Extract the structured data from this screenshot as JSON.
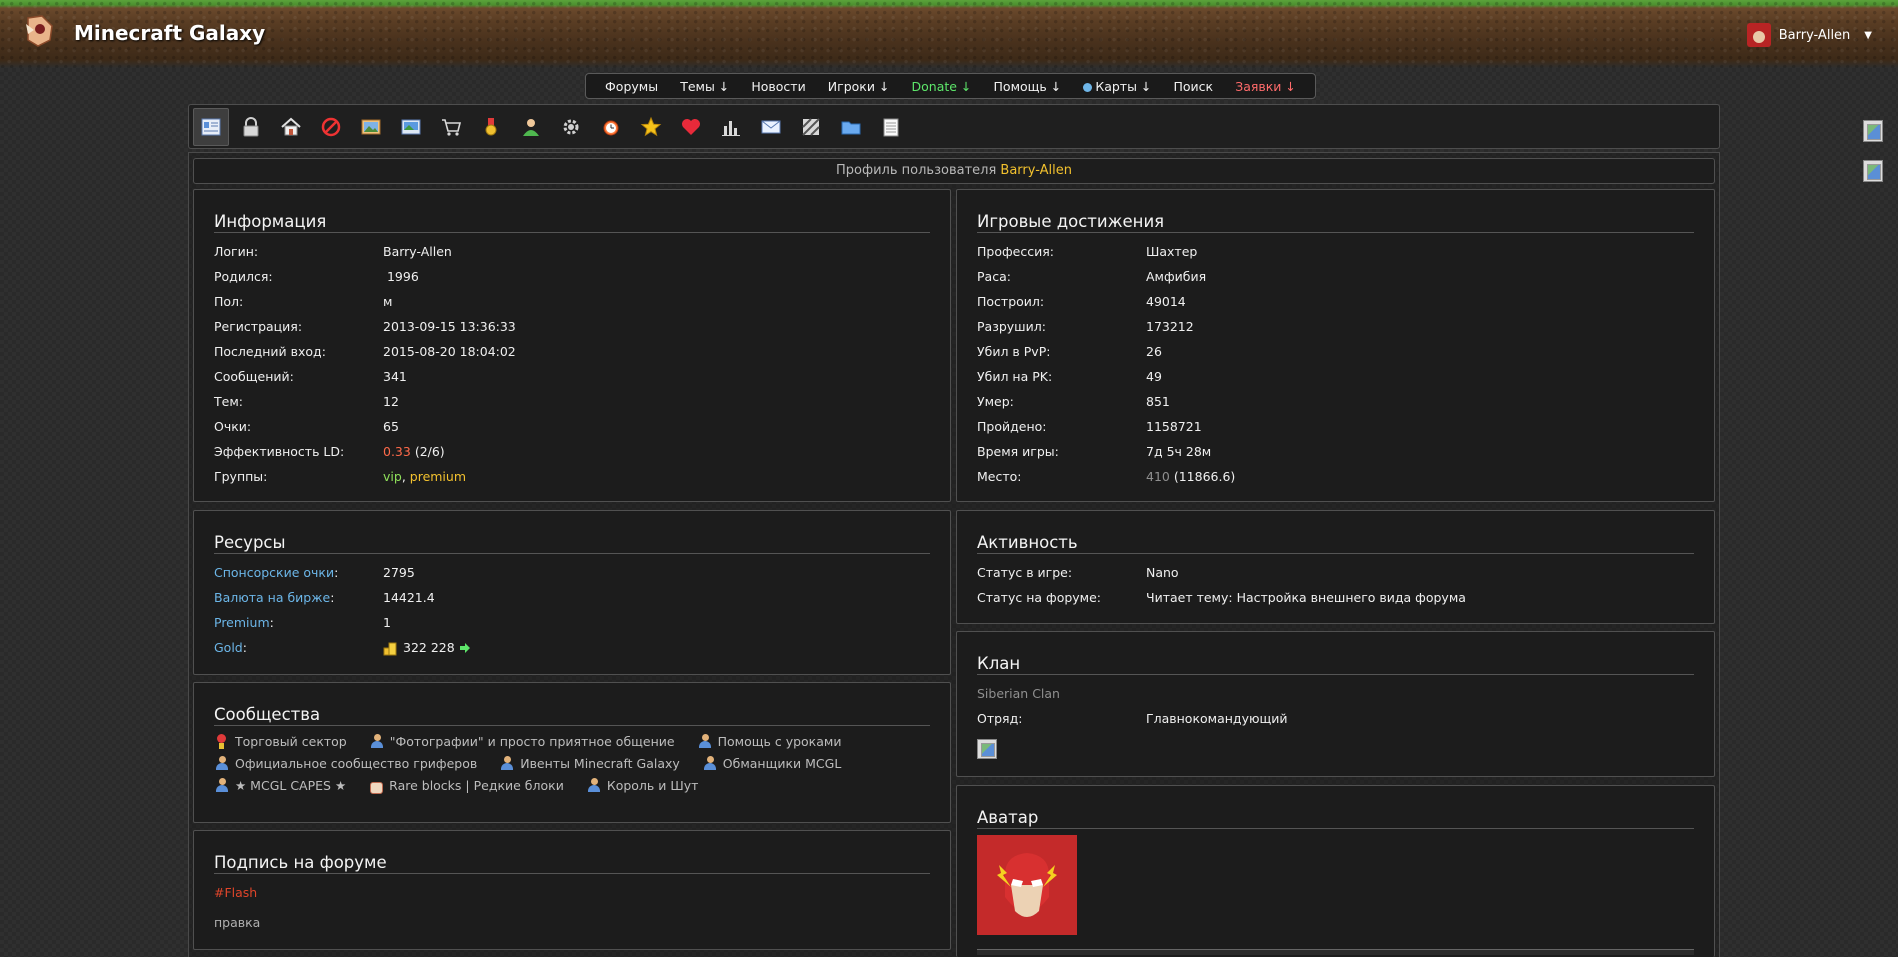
{
  "header": {
    "site_title": "Minecraft Galaxy",
    "username": "Barry-Allen",
    "caret": "▼"
  },
  "nav": [
    {
      "label": "Форумы",
      "style": "normal"
    },
    {
      "label": "Темы ↓",
      "style": "normal"
    },
    {
      "label": "Новости",
      "style": "normal"
    },
    {
      "label": "Игроки ↓",
      "style": "normal"
    },
    {
      "label": "Donate ↓",
      "style": "donate"
    },
    {
      "label": "Помощь ↓",
      "style": "normal"
    },
    {
      "label": "Карты ↓",
      "style": "globe"
    },
    {
      "label": "Поиск",
      "style": "normal"
    },
    {
      "label": "Заявки ↓",
      "style": "zayavki"
    }
  ],
  "toolbar_icons": [
    "profile-card-icon",
    "lock-icon",
    "home-icon",
    "ban-icon",
    "gallery-icon",
    "image-icon",
    "cart-icon",
    "medal-icon",
    "user-icon",
    "gear-icon",
    "alarm-clock-icon",
    "star-icon",
    "heart-icon",
    "bar-chart-icon",
    "mail-icon",
    "stripes-icon",
    "folder-icon",
    "notepad-icon"
  ],
  "profile_bar": {
    "prefix": "Профиль пользователя",
    "username": "Barry-Allen"
  },
  "info": {
    "title": "Информация",
    "login_label": "Логин:",
    "login": "Barry-Allen",
    "born_label": "Родился:",
    "born": " 1996",
    "sex_label": "Пол:",
    "sex": "м",
    "reg_label": "Регистрация:",
    "reg": "2013-09-15 13:36:33",
    "last_label": "Последний вход:",
    "last": "2015-08-20 18:04:02",
    "msgs_label": "Сообщений:",
    "msgs": "341",
    "topics_label": "Тем:",
    "topics": "12",
    "points_label": "Очки:",
    "points": "65",
    "ld_label": "Эффективность LD:",
    "ld_value": "0.33",
    "ld_ratio": " (2/6)",
    "groups_label": "Группы:",
    "group_vip": "vip",
    "group_sep": ", ",
    "group_premium": "premium"
  },
  "achievements": {
    "title": "Игровые достижения",
    "prof_label": "Профессия:",
    "prof": "Шахтер",
    "race_label": "Раса:",
    "race": "Амфибия",
    "built_label": "Построил:",
    "built": "49014",
    "destroyed_label": "Разрушил:",
    "destroyed": "173212",
    "pvp_label": "Убил в PvP:",
    "pvp": "26",
    "pk_label": "Убил на PK:",
    "pk": "49",
    "died_label": "Умер:",
    "died": "851",
    "walked_label": "Пройдено:",
    "walked": "1158721",
    "playtime_label": "Время игры:",
    "playtime": "7д 5ч 28м",
    "place_label": "Место:",
    "place": "410",
    "place_score": " (11866.6)"
  },
  "resources": {
    "title": "Ресурсы",
    "sponsor_label": "Спонсорские очки",
    "sponsor": "2795",
    "exchange_label": "Валюта на бирже",
    "exchange": "14421.4",
    "premium_label": "Premium",
    "premium": "1",
    "gold_label": "Gold",
    "gold": "322 228",
    "colon": ":"
  },
  "activity": {
    "title": "Активность",
    "game_label": "Статус в игре:",
    "game": "Nano",
    "forum_label": "Статус на форуме:",
    "forum": "Читает тему: Настройка внешнего вида форума"
  },
  "communities": {
    "title": "Сообщества",
    "lines": [
      [
        {
          "icon": "medal",
          "label": "Торговый сектор"
        },
        {
          "icon": "people",
          "label": "\"Фотографии\" и просто приятное общение"
        },
        {
          "icon": "people",
          "label": "Помощь с уроками"
        }
      ],
      [
        {
          "icon": "people",
          "label": "Официальное сообщество гриферов"
        },
        {
          "icon": "people",
          "label": "Ивенты Minecraft Galaxy"
        },
        {
          "icon": "people",
          "label": "Обманщики MCGL"
        }
      ],
      [
        {
          "icon": "people",
          "label": "★ MCGL CAPES ★"
        },
        {
          "icon": "cake",
          "label": "Rare blocks | Редкие блоки"
        },
        {
          "icon": "people",
          "label": "Король и Шут"
        }
      ]
    ]
  },
  "clan": {
    "title": "Клан",
    "name": "Siberian Clan",
    "squad_label": "Отряд:",
    "squad": "Главнокомандующий"
  },
  "signature": {
    "title": "Подпись на форуме",
    "tag": "#Flash",
    "text": "правка"
  },
  "avatar": {
    "title": "Аватар"
  },
  "colors": {
    "accent_yellow": "#f2c12e",
    "link_blue": "#6cb6e8",
    "status_green": "#5de66a",
    "alert_red": "#ff6b6b"
  }
}
